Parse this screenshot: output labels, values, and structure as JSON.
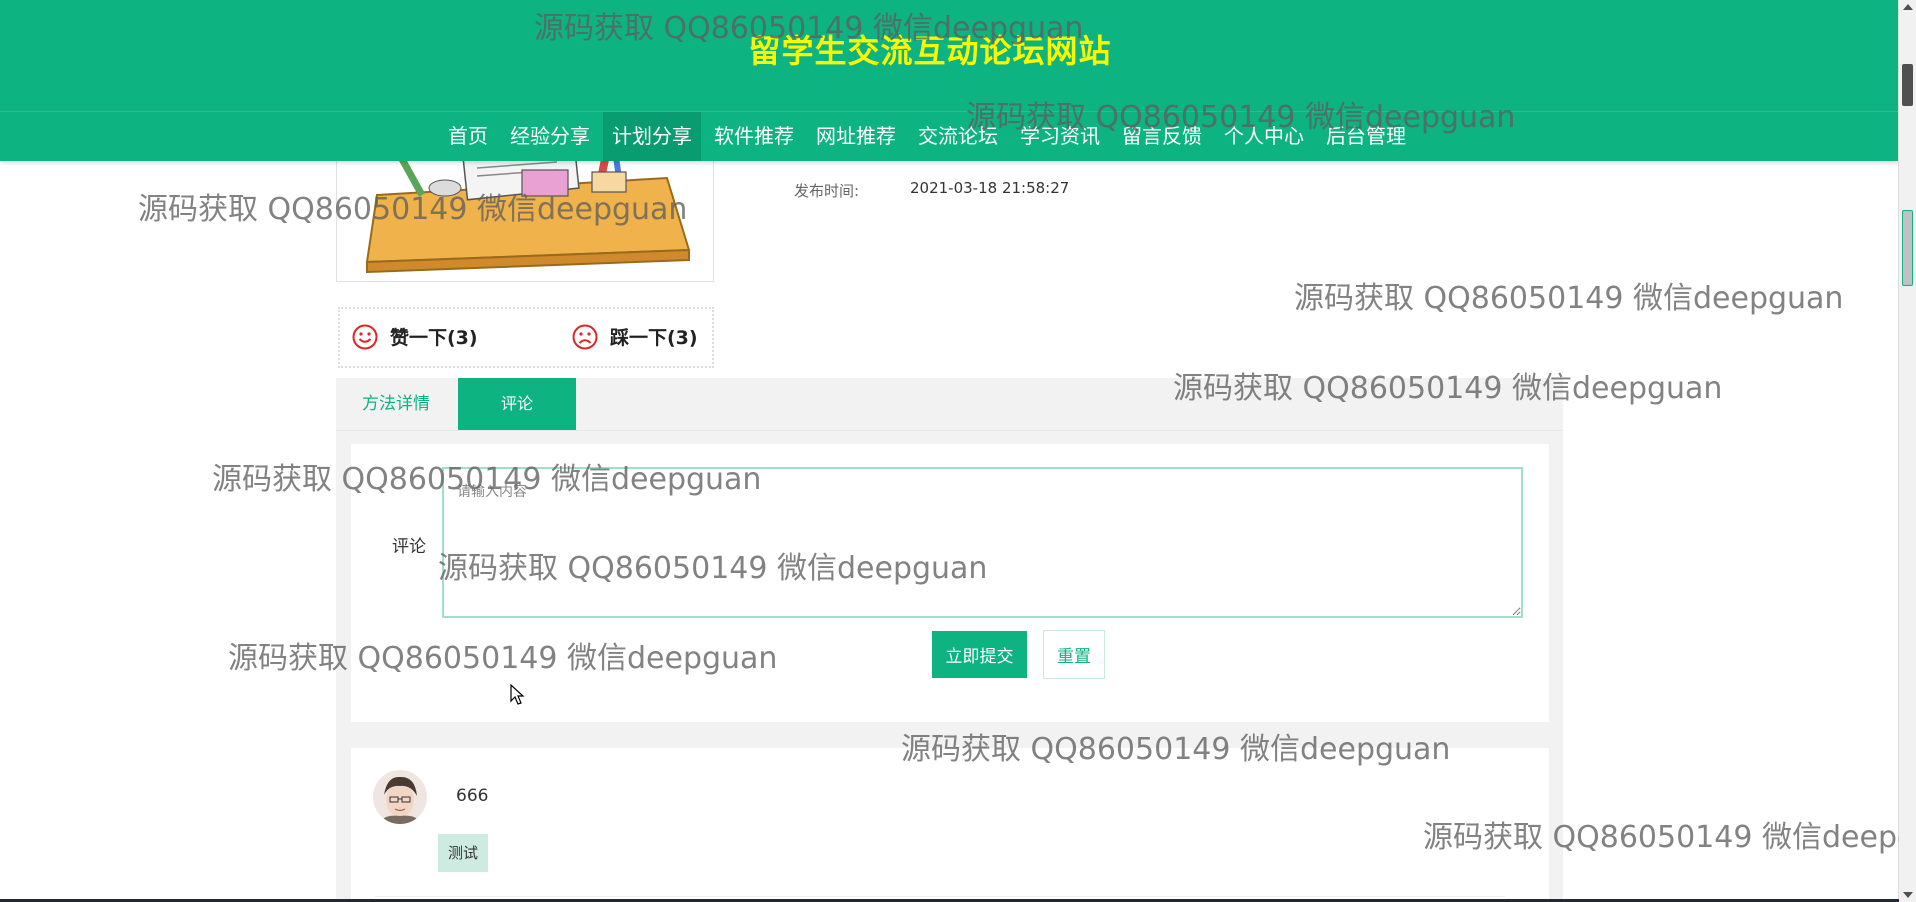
{
  "header": {
    "site_title": "留学生交流互动论坛网站",
    "nav": [
      {
        "label": "首页"
      },
      {
        "label": "经验分享"
      },
      {
        "label": "计划分享",
        "active": true
      },
      {
        "label": "软件推荐"
      },
      {
        "label": "网址推荐"
      },
      {
        "label": "交流论坛"
      },
      {
        "label": "学习资讯"
      },
      {
        "label": "留言反馈"
      },
      {
        "label": "个人中心"
      },
      {
        "label": "后台管理"
      }
    ]
  },
  "detail": {
    "publish_label": "发布时间:",
    "publish_time": "2021-03-18 21:58:27"
  },
  "votes": {
    "like_label": "赞一下(3)",
    "dislike_label": "踩一下(3)"
  },
  "tabs": {
    "detail_label": "方法详情",
    "comment_label": "评论",
    "active": "评论"
  },
  "comment_form": {
    "label": "评论",
    "placeholder": "请输入内容",
    "value": "",
    "submit_label": "立即提交",
    "reset_label": "重置"
  },
  "comments": [
    {
      "user": "666",
      "content": "测试"
    }
  ],
  "watermark": "源码获取 QQ86050149 微信deepguan",
  "colors": {
    "primary": "#0db381",
    "title_yellow": "#f8f800",
    "nav_active": "#0a9c71",
    "tag_bg": "#cdebe1",
    "vote_icon_red": "#e02525"
  }
}
